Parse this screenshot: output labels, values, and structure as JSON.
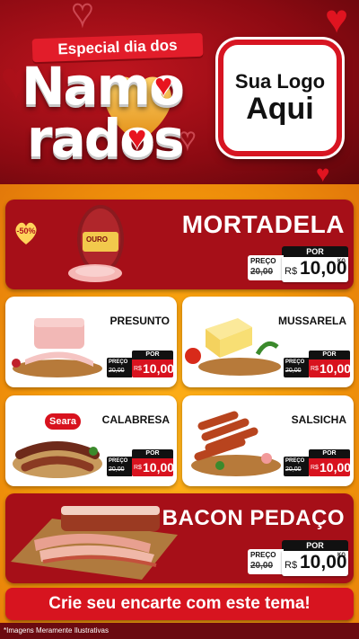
{
  "header": {
    "banner": "Especial dia dos",
    "title_line1": "Namo",
    "title_line2": "rados",
    "logo_line1": "Sua Logo",
    "logo_line2": "Aqui"
  },
  "products": {
    "mortadela": {
      "name": "MORTADELA",
      "badge": "-50%",
      "brand": "OURO",
      "price_label": "PREÇO",
      "old_price": "20,00",
      "por": "POR",
      "currency": "R$",
      "price": "10,00",
      "unit": "KG"
    },
    "presunto": {
      "name": "PRESUNTO",
      "price_label": "PREÇO",
      "old_price": "20,00",
      "por": "POR",
      "currency": "R$",
      "price": "10,00"
    },
    "mussarela": {
      "name": "MUSSARELA",
      "price_label": "PREÇO",
      "old_price": "20,00",
      "por": "POR",
      "currency": "R$",
      "price": "10,00"
    },
    "calabresa": {
      "name": "CALABRESA",
      "brand": "Seara",
      "price_label": "PREÇO",
      "old_price": "20,00",
      "por": "POR",
      "currency": "R$",
      "price": "10,00"
    },
    "salsicha": {
      "name": "SALSICHA",
      "price_label": "PREÇO",
      "old_price": "20,00",
      "por": "POR",
      "currency": "R$",
      "price": "10,00"
    },
    "bacon": {
      "name": "BACON PEDAÇO",
      "price_label": "PREÇO",
      "old_price": "20,00",
      "por": "POR",
      "currency": "R$",
      "price": "10,00",
      "unit": "KG"
    }
  },
  "cta": "Crie seu encarte com este tema!",
  "disclaimer": "*Imagens Meramente Ilustrativas",
  "colors": {
    "red": "#d7141f",
    "dark_red": "#a60f18",
    "orange": "#f59a0a"
  }
}
